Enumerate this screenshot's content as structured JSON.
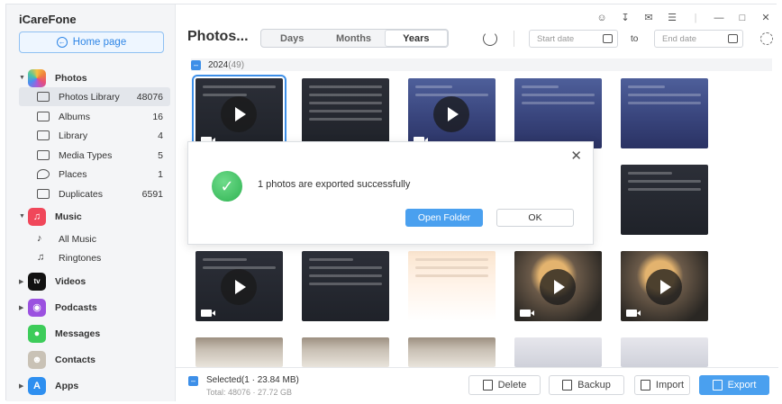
{
  "app": {
    "title": "iCareFone"
  },
  "sidebar": {
    "home_label": "Home page",
    "sections": [
      {
        "label": "Photos",
        "icon": "photos-icon"
      },
      {
        "label": "Music",
        "icon": "music-icon"
      },
      {
        "label": "Videos",
        "icon": "tv-icon"
      },
      {
        "label": "Podcasts",
        "icon": "podcasts-icon"
      },
      {
        "label": "Messages",
        "icon": "messages-icon"
      },
      {
        "label": "Contacts",
        "icon": "contacts-icon"
      },
      {
        "label": "Apps",
        "icon": "appstore-icon"
      }
    ],
    "photos_items": [
      {
        "label": "Photos Library",
        "count": "48076"
      },
      {
        "label": "Albums",
        "count": "16"
      },
      {
        "label": "Library",
        "count": "4"
      },
      {
        "label": "Media Types",
        "count": "5"
      },
      {
        "label": "Places",
        "count": "1"
      },
      {
        "label": "Duplicates",
        "count": "6591"
      }
    ],
    "music_items": [
      {
        "label": "All Music"
      },
      {
        "label": "Ringtones"
      }
    ]
  },
  "toolbar": {
    "title": "Photos...",
    "tabs": [
      "Days",
      "Months",
      "Years"
    ],
    "selected_tab": "Years",
    "start_date_placeholder": "Start date",
    "to_label": "to",
    "end_date_placeholder": "End date"
  },
  "grid": {
    "year": "2024",
    "year_count": "(49)"
  },
  "footer": {
    "selected": "Selected(1 · 23.84 MB)",
    "total": "Total: 48076 · 27.72 GB",
    "delete_label": "Delete",
    "backup_label": "Backup",
    "import_label": "Import",
    "export_label": "Export"
  },
  "dialog": {
    "message": "1 photos are exported successfully",
    "open_folder_label": "Open Folder",
    "ok_label": "OK"
  },
  "colors": {
    "accent": "#4aa0ef",
    "success": "#2fb352"
  }
}
